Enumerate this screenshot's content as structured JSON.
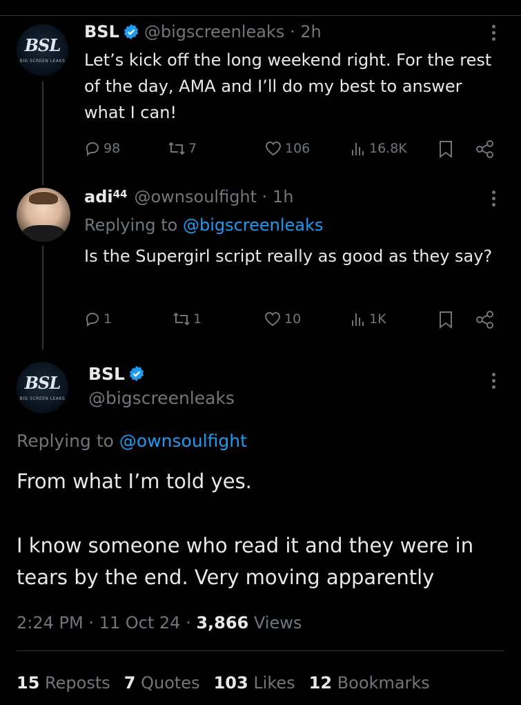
{
  "tweet1": {
    "name": "BSL",
    "handle": "@bigscreenleaks",
    "time": "2h",
    "avatar_text": "BSL",
    "avatar_sub": "BIG SCREEN LEAKS",
    "text": "Let’s kick off the long weekend right. For the rest of the day, AMA and I’ll do my best to answer what I can!",
    "replies": "98",
    "reposts": "7",
    "likes": "106",
    "views": "16.8K"
  },
  "tweet2": {
    "name": "adi",
    "name_sup": "44",
    "handle": "@ownsoulfight",
    "time": "1h",
    "replying_prefix": "Replying to",
    "replying_to": "@bigscreenleaks",
    "text": "Is the Supergirl script really as good as they say?",
    "replies": "1",
    "reposts": "1",
    "likes": "10",
    "views": "1K"
  },
  "main": {
    "name": "BSL",
    "handle": "@bigscreenleaks",
    "replying_prefix": "Replying to",
    "replying_to": "@ownsoulfight",
    "text_p1": "From what I’m told yes.",
    "text_p2": "I know someone who read it and they were in tears by the end. Very moving apparently",
    "time": "2:24 PM",
    "date": "11 Oct 24",
    "views_count": "3,866",
    "views_label": "Views",
    "stats": [
      {
        "count": "15",
        "label": "Reposts"
      },
      {
        "count": "7",
        "label": "Quotes"
      },
      {
        "count": "103",
        "label": "Likes"
      },
      {
        "count": "12",
        "label": "Bookmarks"
      }
    ]
  },
  "colors": {
    "background": "#000000",
    "text": "#e7e9ea",
    "muted": "#71767b",
    "link": "#1d9bf0",
    "verified": "#1d9bf0"
  },
  "icons": [
    "verified-badge-icon",
    "reply-icon",
    "repost-icon",
    "like-icon",
    "views-icon",
    "bookmark-icon",
    "share-icon",
    "more-icon"
  ]
}
